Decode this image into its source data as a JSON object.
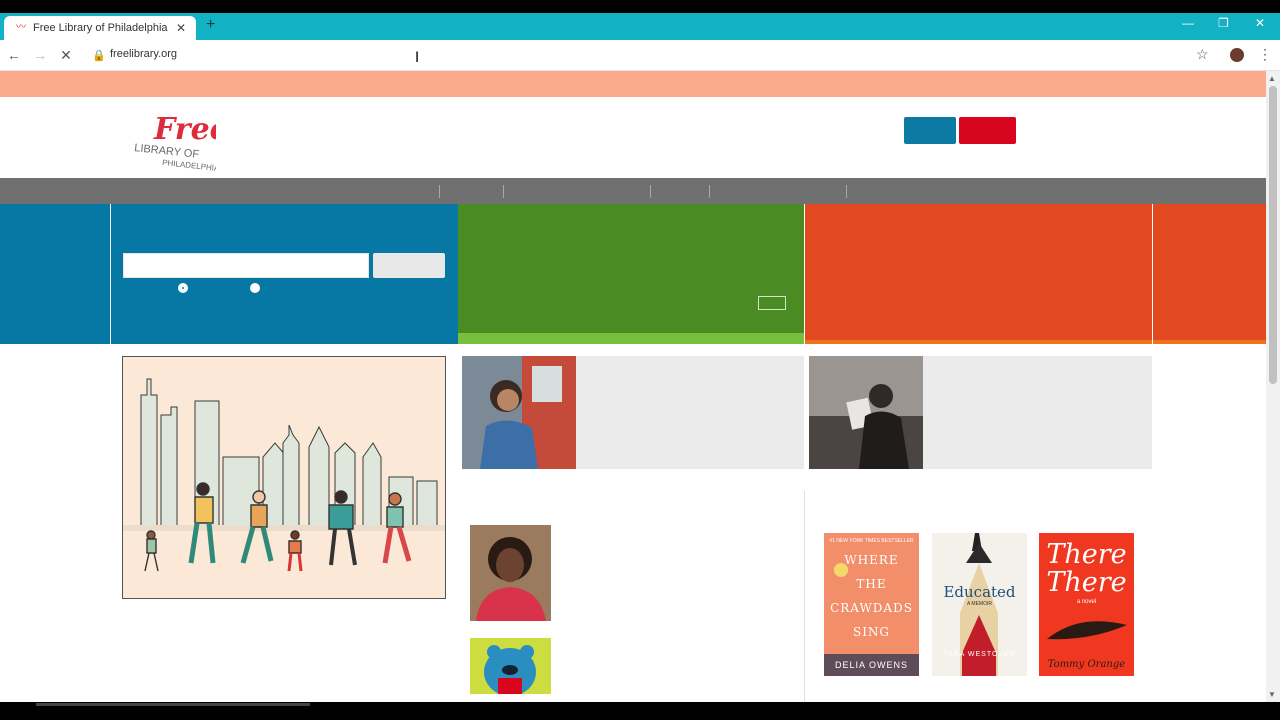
{
  "browser": {
    "tab_title": "Free Library of Philadelphia",
    "favicon": "free-library-favicon",
    "close_tab_label": "✕",
    "new_tab_label": "+",
    "url": "freelibrary.org",
    "window_controls": {
      "minimize": "—",
      "restore": "❐",
      "close": "✕"
    }
  },
  "logo": {
    "word1": "Free",
    "line2": "LIBRARY OF",
    "line3": "PHILADELPHIA"
  },
  "colors": {
    "tab_strip": "#12b2c4",
    "alert_bar": "#fbab8c",
    "nav_bar": "#707070",
    "panel_blue": "#0778a4",
    "panel_green": "#4b8b24",
    "panel_orange": "#e14a20",
    "button_red": "#d7061e"
  },
  "books": [
    {
      "tagline": "#1 NEW YORK TIMES BESTSELLER",
      "title_lines": [
        "WHERE",
        "THE",
        "CRAWDADS",
        "SING"
      ],
      "author": "DELIA OWENS"
    },
    {
      "title_lines": [
        "Educated"
      ],
      "subtitle": "A MEMOIR",
      "author": "TARA WESTOVER"
    },
    {
      "title_lines": [
        "There",
        "There"
      ],
      "subtitle": "a novel",
      "author": "Tommy Orange"
    }
  ]
}
